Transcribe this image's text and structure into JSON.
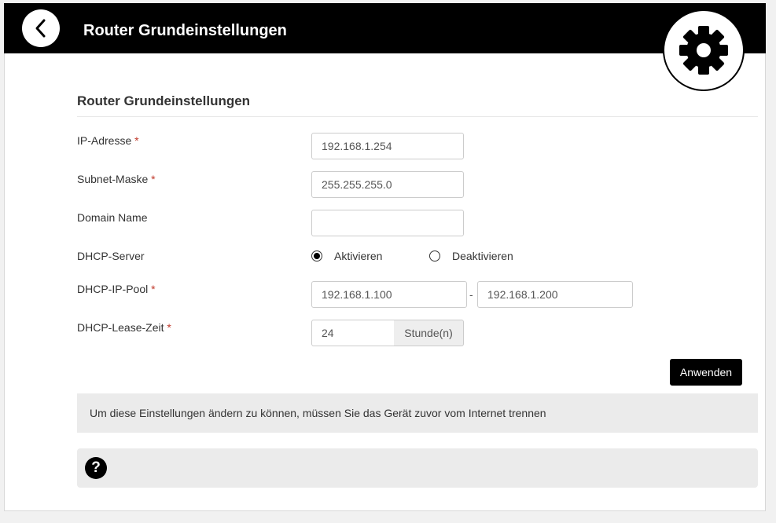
{
  "header": {
    "title": "Router Grundeinstellungen",
    "back_icon": "chevron-left-icon",
    "settings_icon": "gear-icon"
  },
  "section": {
    "title": "Router Grundeinstellungen"
  },
  "form": {
    "required_marker": "*",
    "ip_address": {
      "label": "IP-Adresse",
      "value": "192.168.1.254",
      "required": true
    },
    "subnet_mask": {
      "label": "Subnet-Maske",
      "value": "255.255.255.0",
      "required": true
    },
    "domain_name": {
      "label": "Domain Name",
      "value": "",
      "required": false
    },
    "dhcp_server": {
      "label": "DHCP-Server",
      "options": [
        {
          "label": "Aktivieren",
          "selected": true
        },
        {
          "label": "Deaktivieren",
          "selected": false
        }
      ]
    },
    "dhcp_pool": {
      "label": "DHCP-IP-Pool",
      "required": true,
      "start": "192.168.1.100",
      "separator": "-",
      "end": "192.168.1.200"
    },
    "dhcp_lease": {
      "label": "DHCP-Lease-Zeit",
      "required": true,
      "value": "24",
      "unit": "Stunde(n)"
    }
  },
  "actions": {
    "apply_label": "Anwenden"
  },
  "notice": {
    "text": "Um diese Einstellungen ändern zu können, müssen Sie das Gerät zuvor vom Internet trennen"
  },
  "help": {
    "icon": "help-icon",
    "glyph": "?"
  }
}
